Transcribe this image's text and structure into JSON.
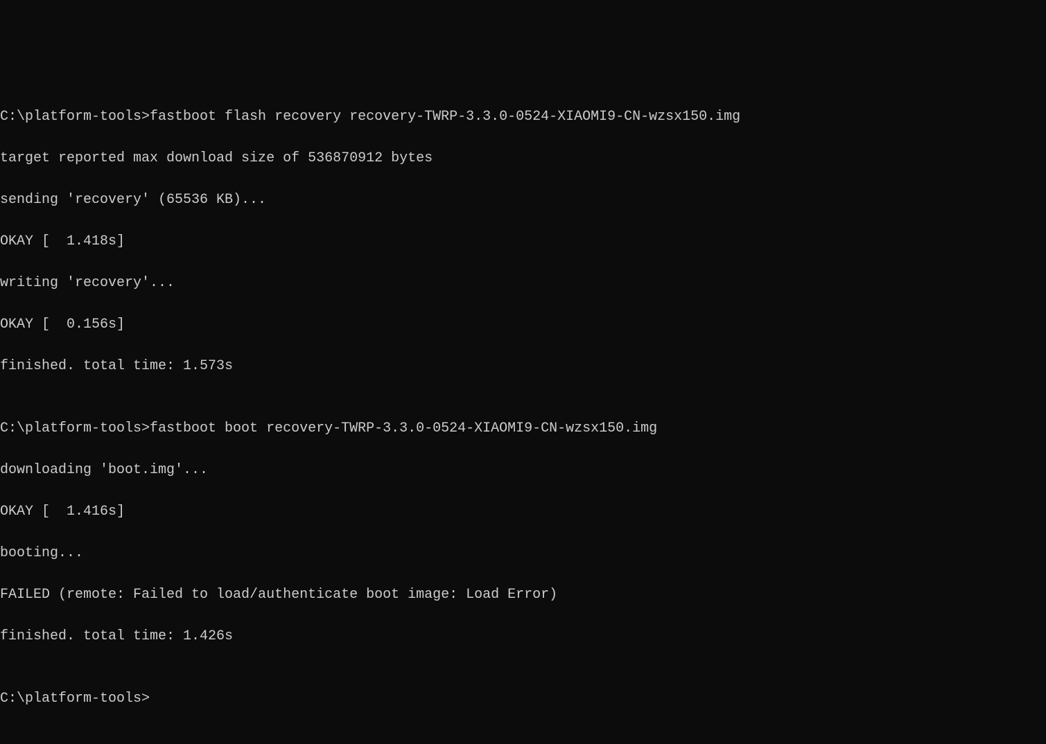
{
  "terminal": {
    "lines": [
      "C:\\platform-tools>fastboot flash recovery recovery-TWRP-3.3.0-0524-XIAOMI9-CN-wzsx150.img",
      "target reported max download size of 536870912 bytes",
      "sending 'recovery' (65536 KB)...",
      "OKAY [  1.418s]",
      "writing 'recovery'...",
      "OKAY [  0.156s]",
      "finished. total time: 1.573s",
      "",
      "C:\\platform-tools>fastboot boot recovery-TWRP-3.3.0-0524-XIAOMI9-CN-wzsx150.img",
      "downloading 'boot.img'...",
      "OKAY [  1.416s]",
      "booting...",
      "FAILED (remote: Failed to load/authenticate boot image: Load Error)",
      "finished. total time: 1.426s",
      "",
      "C:\\platform-tools>"
    ]
  }
}
